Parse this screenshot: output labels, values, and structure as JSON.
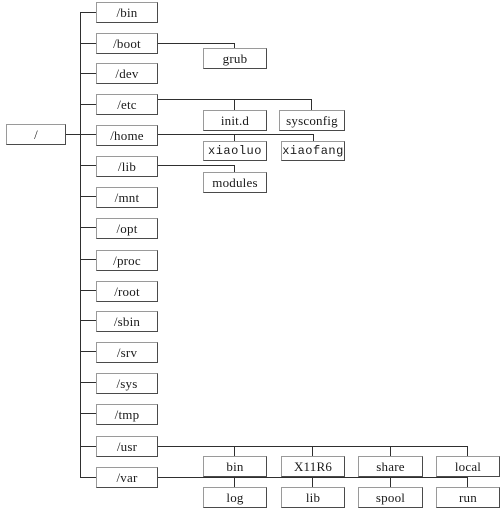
{
  "diagram": {
    "title": "Linux filesystem hierarchy tree",
    "type": "tree",
    "style": {
      "background": "#ffffff",
      "box_border_light": "#9a9a9a",
      "box_border_dark": "#4a4a4a",
      "line_color": "#2f2f2f",
      "text_color": "#1a1a1a"
    },
    "root": {
      "label": "/"
    },
    "level1": [
      {
        "label": "/bin"
      },
      {
        "label": "/boot"
      },
      {
        "label": "/dev"
      },
      {
        "label": "/etc"
      },
      {
        "label": "/home"
      },
      {
        "label": "/lib"
      },
      {
        "label": "/mnt"
      },
      {
        "label": "/opt"
      },
      {
        "label": "/proc"
      },
      {
        "label": "/root"
      },
      {
        "label": "/sbin"
      },
      {
        "label": "/srv"
      },
      {
        "label": "/sys"
      },
      {
        "label": "/tmp"
      },
      {
        "label": "/usr"
      },
      {
        "label": "/var"
      }
    ],
    "children": {
      "boot": [
        {
          "label": "grub"
        }
      ],
      "etc": [
        {
          "label": "init.d"
        },
        {
          "label": "sysconfig"
        }
      ],
      "home": [
        {
          "label": "xiaoluo"
        },
        {
          "label": "xiaofang"
        }
      ],
      "lib": [
        {
          "label": "modules"
        }
      ],
      "usr": [
        {
          "label": "bin"
        },
        {
          "label": "X11R6"
        },
        {
          "label": "share"
        },
        {
          "label": "local"
        }
      ],
      "var": [
        {
          "label": "log"
        },
        {
          "label": "lib"
        },
        {
          "label": "spool"
        },
        {
          "label": "run"
        }
      ]
    }
  }
}
